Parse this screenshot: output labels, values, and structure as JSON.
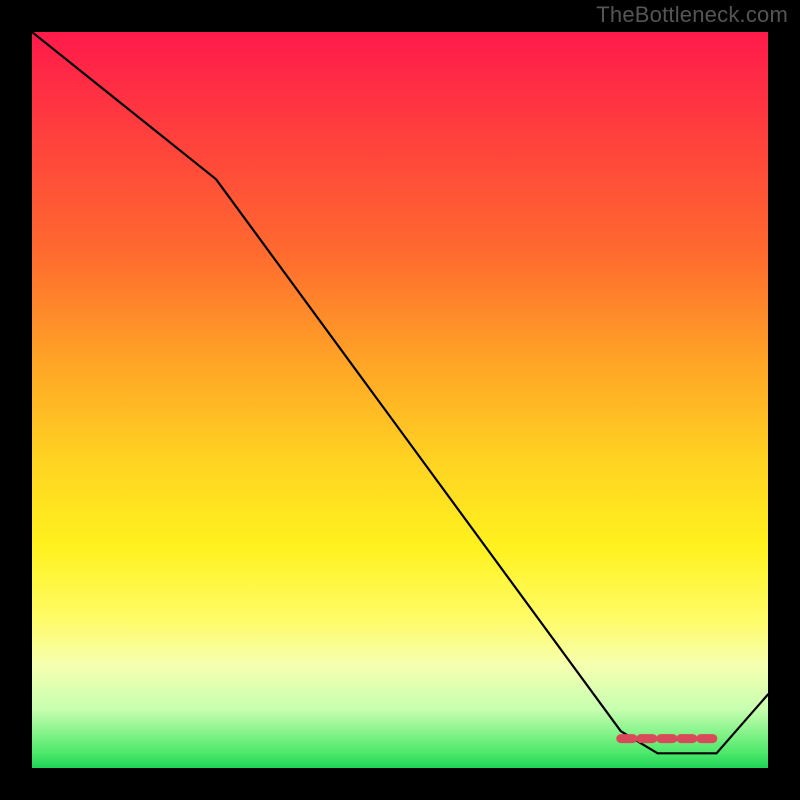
{
  "watermark": "TheBottleneck.com",
  "chart_data": {
    "type": "line",
    "title": "",
    "xlabel": "",
    "ylabel": "",
    "xlim": [
      0,
      100
    ],
    "ylim": [
      0,
      100
    ],
    "grid": false,
    "legend": false,
    "series": [
      {
        "name": "bottleneck-curve",
        "x": [
          0,
          25,
          80,
          85,
          93,
          100
        ],
        "values": [
          100,
          80,
          5,
          2,
          2,
          10
        ]
      }
    ],
    "highlight": {
      "name": "optimal-range",
      "x": [
        80,
        93
      ],
      "values": [
        4,
        4
      ]
    },
    "background_gradient": {
      "orientation": "vertical",
      "stops": [
        {
          "pos": 0.0,
          "color": "#ff1a4b"
        },
        {
          "pos": 0.3,
          "color": "#ff6a2f"
        },
        {
          "pos": 0.58,
          "color": "#ffd222"
        },
        {
          "pos": 0.8,
          "color": "#fffc6a"
        },
        {
          "pos": 0.98,
          "color": "#4ce86a"
        },
        {
          "pos": 1.0,
          "color": "#1fd457"
        }
      ]
    }
  }
}
